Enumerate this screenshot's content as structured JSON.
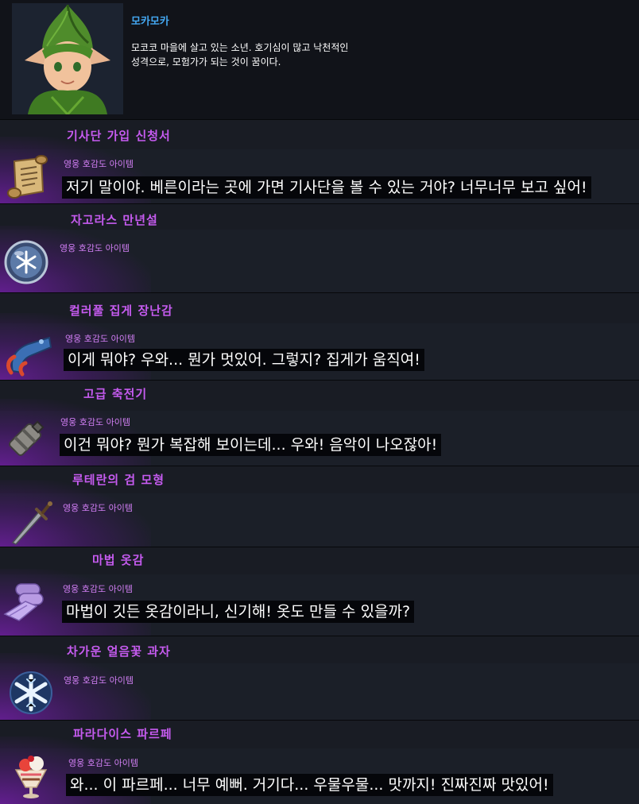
{
  "character": {
    "name": "모카모카",
    "description": "모코코 마을에 살고 있는 소년. 호기심이 많고 낙천적인 성격으로, 모험가가 되는 것이 꿈이다."
  },
  "colors": {
    "name_accent": "#44a8f2",
    "section_title": "#c65bf0",
    "grade_label": "#d27ff5",
    "glow": "#6e1ea0"
  },
  "items": [
    {
      "title": "기사단 가입 신청서",
      "grade": "영웅 호감도 아이템",
      "icon": "scroll-icon",
      "quote": "저기 말이야. 베른이라는 곳에 가면 기사단을 볼 수 있는 거야? 너무너무 보고 싶어!"
    },
    {
      "title": "자고라스 만년설",
      "grade": "영웅 호감도 아이템",
      "icon": "snow-globe-icon",
      "quote": ""
    },
    {
      "title": "컬러풀 집게 장난감",
      "grade": "영웅 호감도 아이템",
      "icon": "claw-toy-icon",
      "quote": "이게 뭐야? 우와... 뭔가 멋있어. 그렇지? 집게가 움직여!"
    },
    {
      "title": "고급 축전기",
      "grade": "영웅 호감도 아이템",
      "icon": "capacitor-icon",
      "quote": "이건 뭐야? 뭔가 복잡해 보이는데... 우와! 음악이 나오잖아!"
    },
    {
      "title": "루테란의 검 모형",
      "grade": "영웅 호감도 아이템",
      "icon": "sword-icon",
      "quote": ""
    },
    {
      "title": "마법 옷감",
      "grade": "영웅 호감도 아이템",
      "icon": "fabric-icon",
      "quote": "마법이 깃든 옷감이라니, 신기해! 옷도 만들 수 있을까?"
    },
    {
      "title": "차가운 얼음꽃 과자",
      "grade": "영웅 호감도 아이템",
      "icon": "snowflake-cookie-icon",
      "quote": ""
    },
    {
      "title": "파라다이스 파르페",
      "grade": "영웅 호감도 아이템",
      "icon": "parfait-icon",
      "quote": "와... 이 파르페... 너무 예뻐. 거기다... 우물우물... 맛까지! 진짜진짜 맛있어!"
    }
  ]
}
